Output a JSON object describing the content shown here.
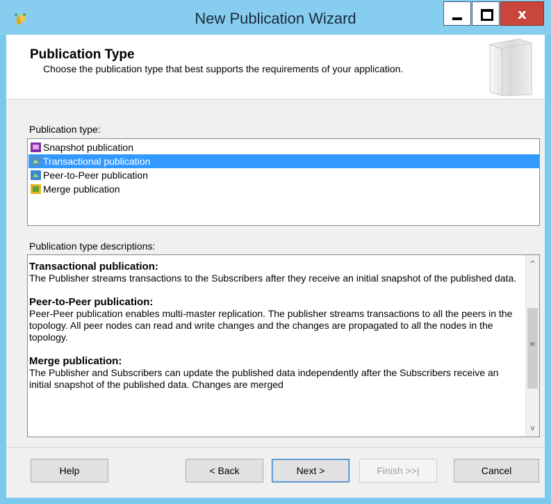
{
  "window": {
    "title": "New Publication Wizard",
    "controls": {
      "close_glyph": "x"
    },
    "icons": [
      "wizard-app-icon",
      "minimize-icon",
      "maximize-icon",
      "close-icon"
    ]
  },
  "header": {
    "title": "Publication Type",
    "subtitle": "Choose the publication type that best supports the requirements of your application.",
    "icon": "book-icon"
  },
  "publication_types": {
    "label": "Publication type:",
    "selected_index": 1,
    "items": [
      {
        "label": "Snapshot publication",
        "icon": "snapshot-publication-icon"
      },
      {
        "label": "Transactional publication",
        "icon": "transactional-publication-icon"
      },
      {
        "label": "Peer-to-Peer publication",
        "icon": "peer-to-peer-publication-icon"
      },
      {
        "label": "Merge publication",
        "icon": "merge-publication-icon"
      }
    ]
  },
  "descriptions": {
    "label": "Publication type descriptions:",
    "items": [
      {
        "heading": "Transactional publication:",
        "text": "The Publisher streams transactions to the Subscribers after they receive an initial snapshot of the published data."
      },
      {
        "heading": "Peer-to-Peer publication:",
        "text": "Peer-Peer publication enables multi-master replication. The publisher streams transactions to all the peers in the topology. All peer nodes can read and write changes and the changes are propagated to all the nodes in the topology."
      },
      {
        "heading": "Merge publication:",
        "text": "The Publisher and Subscribers can update the published data independently after the Subscribers receive an initial snapshot of the published data. Changes are merged"
      }
    ],
    "scrollbar": {
      "up_glyph": "^",
      "down_glyph": "v",
      "grip_glyph": "≡"
    }
  },
  "buttons": {
    "help": "Help",
    "back": "< Back",
    "next": "Next >",
    "finish": "Finish >>|",
    "cancel": "Cancel"
  },
  "colors": {
    "titlebar": "#87cdef",
    "selection": "#3399ff",
    "close_button": "#c9463d"
  }
}
